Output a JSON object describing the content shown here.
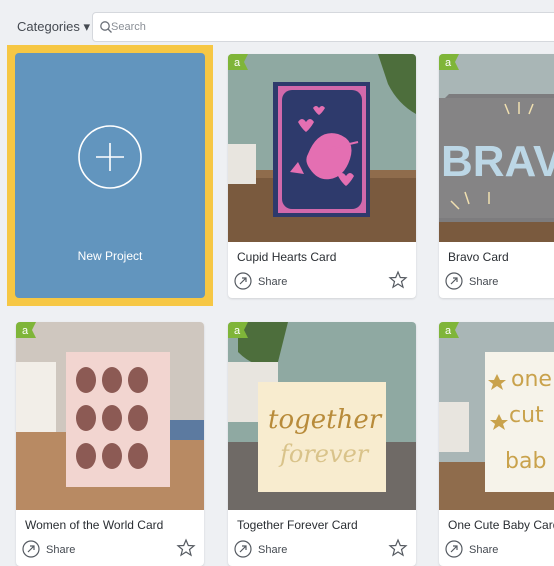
{
  "header": {
    "categories_label": "Categories ▾",
    "search_placeholder": "Search"
  },
  "new_project": {
    "label": "New Project",
    "highlight_color": "#f6c744",
    "tile_color": "#6295be"
  },
  "projects": [
    {
      "title": "Cupid Hearts Card",
      "share_label": "Share",
      "badge": "a"
    },
    {
      "title": "Bravo Card",
      "share_label": "Share",
      "badge": "a"
    },
    {
      "title": "Women of the World Card",
      "share_label": "Share",
      "badge": "a"
    },
    {
      "title": "Together Forever Card",
      "share_label": "Share",
      "badge": "a"
    },
    {
      "title": "One Cute Baby Card",
      "share_label": "Share",
      "badge": "a"
    }
  ],
  "card_art": {
    "bravo_text": "BRAV",
    "together_text": "together",
    "forever_text": "forever",
    "baby_line1": "one",
    "baby_line2": "cut",
    "baby_line3": "bab"
  },
  "colors": {
    "badge_green": "#7fb539",
    "page_bg": "#eef0f3"
  }
}
